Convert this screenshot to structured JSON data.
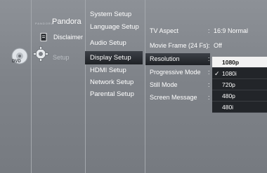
{
  "left_column": {
    "disc_label": "DVD",
    "pandora_logo": "PANDORA",
    "pandora": "Pandora",
    "disclaimer": "Disclaimer",
    "setup": "Setup"
  },
  "setup_menu": {
    "items": [
      {
        "label": "System Setup"
      },
      {
        "label": "Language Setup"
      },
      {
        "label": "Audio Setup"
      },
      {
        "label": "Display Setup",
        "selected": true
      },
      {
        "label": "HDMI Setup"
      },
      {
        "label": "Network Setup"
      },
      {
        "label": "Parental Setup"
      }
    ]
  },
  "display_options": {
    "items": [
      {
        "label": "TV Aspect",
        "value": "16:9 Normal"
      },
      {
        "label": "Movie Frame (24 Fs)",
        "value": "Off"
      },
      {
        "label": "Resolution",
        "value": "",
        "selected": true
      },
      {
        "label": "Progressive Mode",
        "value": ""
      },
      {
        "label": "Still Mode",
        "value": ""
      },
      {
        "label": "Screen Message",
        "value": ""
      }
    ]
  },
  "resolution_dropdown": {
    "options": [
      {
        "label": "1080p",
        "highlighted": true,
        "checked": false
      },
      {
        "label": "1080i",
        "highlighted": false,
        "checked": true
      },
      {
        "label": "720p",
        "highlighted": false,
        "checked": false
      },
      {
        "label": "480p",
        "highlighted": false,
        "checked": false
      },
      {
        "label": "480i",
        "highlighted": false,
        "checked": false
      }
    ],
    "check_glyph": "✓"
  }
}
